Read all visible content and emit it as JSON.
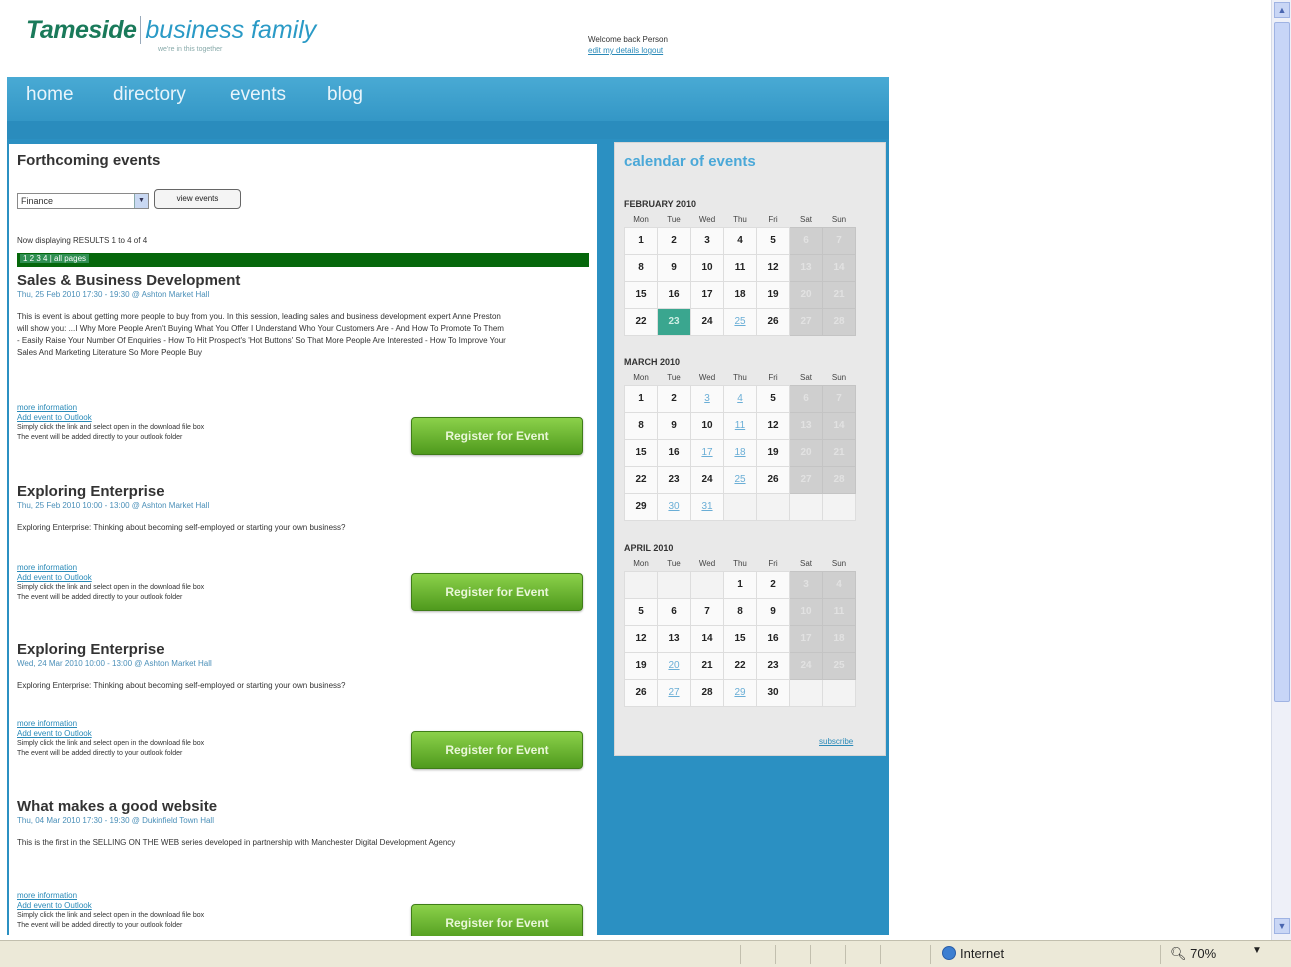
{
  "header": {
    "brand_bold": "Tameside",
    "brand_light": "business family",
    "tagline": "we're in this together",
    "welcome_text": "Welcome back Person",
    "welcome_link": "edit my details logout"
  },
  "nav": {
    "items": [
      "home",
      "directory",
      "events",
      "blog"
    ]
  },
  "main": {
    "heading": "Forthcoming events",
    "filter_value": "Finance",
    "view_button": "view events",
    "showing": "Now displaying RESULTS 1 to 4 of 4",
    "pager": "1 2 3 4 | all pages"
  },
  "events": [
    {
      "title": "Sales & Business Development",
      "meta": "Thu, 25 Feb 2010 17:30 - 19:30 @ Ashton Market Hall",
      "desc": "This is event is about getting more people to buy from you. In this session, leading sales and business development expert Anne Preston will show you: ...I Why More People Aren't Buying What You Offer I Understand Who Your Customers Are - And How To Promote To Them - Easily Raise Your Number Of Enquiries - How To Hit Prospect's 'Hot Buttons' So That More People Are Interested - How To Improve Your Sales And Marketing Literature So More People Buy",
      "more": "more information",
      "outlook": "Add event to Outlook",
      "hint1": "Simply click the link and select open in the download file box",
      "hint2": "The event will be added directly to your outlook folder",
      "button": "Register for Event"
    },
    {
      "title": "Exploring Enterprise",
      "meta": "Thu, 25 Feb 2010 10:00 - 13:00 @ Ashton Market Hall",
      "desc": "Exploring Enterprise: Thinking about becoming self-employed or starting your own business?",
      "more": "more information",
      "outlook": "Add event to Outlook",
      "hint1": "Simply click the link and select open in the download file box",
      "hint2": "The event will be added directly to your outlook folder",
      "button": "Register for Event"
    },
    {
      "title": "Exploring Enterprise",
      "meta": "Wed, 24 Mar 2010 10:00 - 13:00 @ Ashton Market Hall",
      "desc": "Exploring Enterprise: Thinking about becoming self-employed or starting your own business?",
      "more": "more information",
      "outlook": "Add event to Outlook",
      "hint1": "Simply click the link and select open in the download file box",
      "hint2": "The event will be added directly to your outlook folder",
      "button": "Register for Event"
    },
    {
      "title": "What makes a good website",
      "meta": "Thu, 04 Mar 2010 17:30 - 19:30 @ Dukinfield Town Hall",
      "desc": "This is the first in the SELLING ON THE WEB series developed in partnership with Manchester Digital Development Agency",
      "more": "more information",
      "outlook": "Add event to Outlook",
      "hint1": "Simply click the link and select open in the download file box",
      "hint2": "The event will be added directly to your outlook folder",
      "button": "Register for Event"
    }
  ],
  "calendar": {
    "title": "calendar of events",
    "weekdays": [
      "Mon",
      "Tue",
      "Wed",
      "Thu",
      "Fri",
      "Sat",
      "Sun"
    ],
    "months": [
      {
        "name": "FEBRUARY 2010",
        "weeks": [
          [
            "1",
            "2",
            "3",
            "4",
            "5",
            "6",
            "7"
          ],
          [
            "8",
            "9",
            "10",
            "11",
            "12",
            "13",
            "14"
          ],
          [
            "15",
            "16",
            "17",
            "18",
            "19",
            "20",
            "21"
          ],
          [
            "22",
            "23",
            "24",
            "25",
            "26",
            "27",
            "28"
          ]
        ],
        "links": [
          "25"
        ],
        "today": "23"
      },
      {
        "name": "MARCH 2010",
        "weeks": [
          [
            "1",
            "2",
            "3",
            "4",
            "5",
            "6",
            "7"
          ],
          [
            "8",
            "9",
            "10",
            "11",
            "12",
            "13",
            "14"
          ],
          [
            "15",
            "16",
            "17",
            "18",
            "19",
            "20",
            "21"
          ],
          [
            "22",
            "23",
            "24",
            "25",
            "26",
            "27",
            "28"
          ],
          [
            "29",
            "30",
            "31",
            "",
            "",
            "",
            ""
          ]
        ],
        "links": [
          "3",
          "4",
          "11",
          "17",
          "18",
          "25",
          "30",
          "31"
        ],
        "today": ""
      },
      {
        "name": "APRIL 2010",
        "weeks": [
          [
            "",
            "",
            "",
            "1",
            "2",
            "3",
            "4"
          ],
          [
            "5",
            "6",
            "7",
            "8",
            "9",
            "10",
            "11"
          ],
          [
            "12",
            "13",
            "14",
            "15",
            "16",
            "17",
            "18"
          ],
          [
            "19",
            "20",
            "21",
            "22",
            "23",
            "24",
            "25"
          ],
          [
            "26",
            "27",
            "28",
            "29",
            "30",
            "",
            ""
          ]
        ],
        "links": [
          "20",
          "27",
          "29"
        ],
        "today": ""
      }
    ],
    "subscribe": "subscribe"
  },
  "statusbar": {
    "zone": "Internet",
    "zoom": "70%"
  },
  "colors": {
    "nav_blue": "#2b90c2",
    "button_green": "#5fae26",
    "heading_blue": "#4aa8d8",
    "pager_green": "#05670b"
  }
}
